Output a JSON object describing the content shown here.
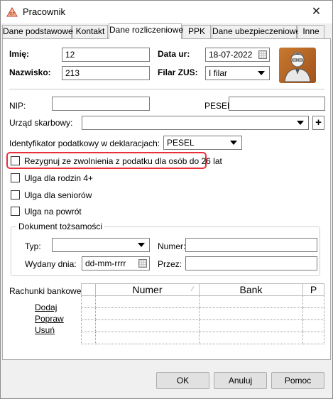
{
  "window": {
    "title": "Pracownik"
  },
  "tabs": [
    {
      "label": "Dane podstawowe"
    },
    {
      "label": "Kontakt"
    },
    {
      "label": "Dane rozliczeniowe"
    },
    {
      "label": "PPK"
    },
    {
      "label": "Dane ubezpieczeniowe"
    },
    {
      "label": "Inne"
    }
  ],
  "active_tab": "Dane rozliczeniowe",
  "header": {
    "imie_label": "Imię:",
    "imie_value": "12",
    "nazwisko_label": "Nazwisko:",
    "nazwisko_value": "213",
    "data_ur_label": "Data ur:",
    "data_ur_value": "18-07-2022",
    "filar_label": "Filar ZUS:",
    "filar_value": "I filar"
  },
  "tax": {
    "nip_label": "NIP:",
    "nip_value": "",
    "pesel_label": "PESEL:",
    "pesel_value": "",
    "urzad_label": "Urząd skarbowy:",
    "urzad_value": "",
    "urzad_add": "+",
    "ident_label": "Identyfikator podatkowy w deklaracjach:",
    "ident_value": "PESEL"
  },
  "checkboxes": [
    {
      "label": "Rezygnuj ze zwolnienia z podatku dla osób do 26 lat",
      "checked": false,
      "highlighted": true
    },
    {
      "label": "Ulga dla rodzin 4+",
      "checked": false
    },
    {
      "label": "Ulga dla seniorów",
      "checked": false
    },
    {
      "label": "Ulga na powrót",
      "checked": false
    }
  ],
  "document": {
    "group_title": "Dokument tożsamości",
    "typ_label": "Typ:",
    "typ_value": "",
    "numer_label": "Numer:",
    "numer_value": "",
    "wydany_label": "Wydany dnia:",
    "wydany_value": "dd-mm-rrrr",
    "przez_label": "Przez:",
    "przez_value": ""
  },
  "bank": {
    "label": "Rachunki bankowe:",
    "actions": [
      "Dodaj",
      "Popraw",
      "Usuń"
    ],
    "columns": [
      "Numer",
      "Bank",
      "P"
    ],
    "rows": [
      [
        "",
        "",
        ""
      ],
      [
        "",
        "",
        ""
      ],
      [
        "",
        "",
        ""
      ],
      [
        "",
        "",
        ""
      ]
    ]
  },
  "footer": {
    "ok": "OK",
    "cancel": "Anuluj",
    "help": "Pomoc"
  },
  "colors": {
    "highlight": "#e8303a",
    "avatar": "#b8662a"
  }
}
